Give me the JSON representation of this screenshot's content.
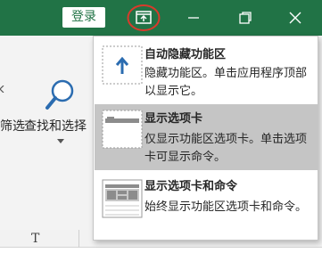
{
  "titlebar": {
    "login_label": "登录",
    "accent_color": "#217346"
  },
  "ribbon": {
    "filter_label_partial": "筛选",
    "find_select_label": "查找和选择"
  },
  "sheet": {
    "column_label": "T"
  },
  "ribbon_display_menu": {
    "items": [
      {
        "title": "自动隐藏功能区",
        "description": "隐藏功能区。单击应用程序顶部以显示它。",
        "icon": "arrow-up-icon",
        "selected": false
      },
      {
        "title": "显示选项卡",
        "description": "仅显示功能区选项卡。单击选项卡可显示命令。",
        "icon": "tabs-only-icon",
        "selected": true
      },
      {
        "title": "显示选项卡和命令",
        "description": "始终显示功能区选项卡和命令。",
        "icon": "tabs-and-commands-icon",
        "selected": false
      }
    ]
  }
}
